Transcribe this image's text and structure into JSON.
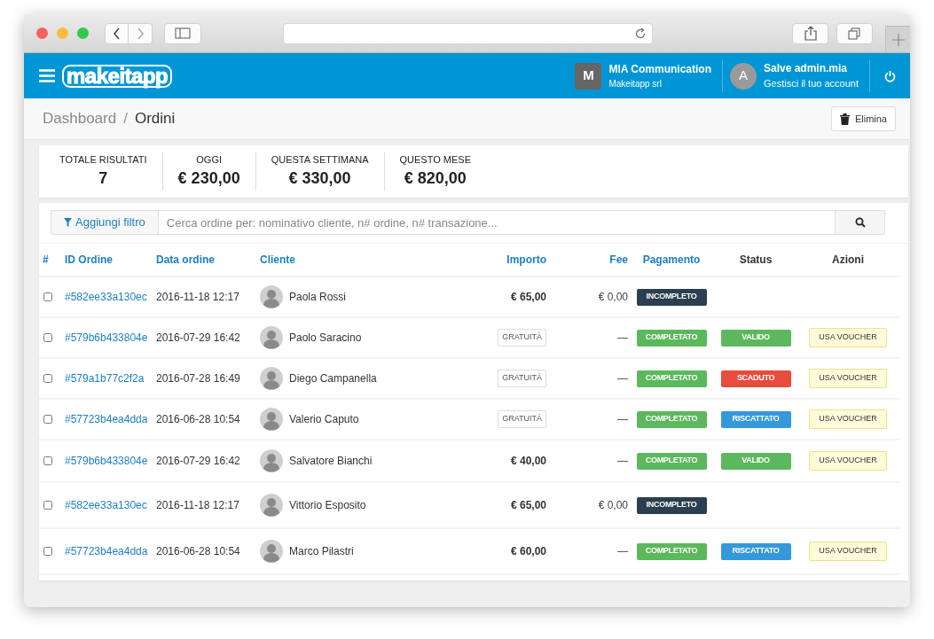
{
  "header": {
    "logo": "makeitapp",
    "company": {
      "initial": "M",
      "name": "MIA Communication",
      "subtitle": "Makeitapp srl"
    },
    "user": {
      "initial": "A",
      "greeting": "Salve admin.mia",
      "link": "Gestisci il tuo account"
    }
  },
  "breadcrumb": {
    "items": [
      {
        "label": "Dashboard",
        "selected": false
      },
      {
        "label": "Ordini",
        "selected": true
      }
    ],
    "separator": "/"
  },
  "delete_button": "Elimina",
  "stats": [
    {
      "label": "TOTALE RISULTATI",
      "value": "7"
    },
    {
      "label": "OGGI",
      "value": "€ 230,00"
    },
    {
      "label": "QUESTA SETTIMANA",
      "value": "€ 330,00"
    },
    {
      "label": "QUESTO MESE",
      "value": "€ 820,00"
    }
  ],
  "filter_button": "Aggiungi filtro",
  "search": {
    "placeholder": "Cerca ordine per: nominativo cliente, n# ordine, n# transazione..."
  },
  "table": {
    "columns": [
      {
        "label": "#",
        "sortable": true
      },
      {
        "label": "ID Ordine",
        "sortable": true
      },
      {
        "label": "Data ordine",
        "sortable": true
      },
      {
        "label": "Cliente",
        "sortable": true
      },
      {
        "label": "Importo",
        "sortable": true
      },
      {
        "label": "Fee",
        "sortable": true
      },
      {
        "label": "Pagamento",
        "sortable": true
      },
      {
        "label": "Status",
        "sortable": false
      },
      {
        "label": "Azioni",
        "sortable": false
      }
    ],
    "rows": [
      {
        "checked": false,
        "id": "#582ee33a130ec",
        "date": "2016-11-18 12:17",
        "client": "Paola Rossi",
        "amount": {
          "kind": "price",
          "text": "€ 65,00"
        },
        "fee": "€ 0,00",
        "payment": {
          "text": "INCOMPLETO",
          "color": "#2c3e50"
        }
      },
      {
        "checked": false,
        "id": "#579b6b433804e",
        "date": "2016-07-29 16:42",
        "client": "Paolo Saracino",
        "amount": {
          "kind": "tag",
          "text": "GRATUITÀ"
        },
        "fee": "—",
        "payment": {
          "text": "COMPLETATO",
          "color": "#5cb85c"
        },
        "status": {
          "text": "VALIDO",
          "color": "#5cb85c"
        },
        "action": "USA VOUCHER"
      },
      {
        "checked": false,
        "id": "#579a1b77c2f2a",
        "date": "2016-07-28 16:49",
        "client": "Diego Campanella",
        "amount": {
          "kind": "tag",
          "text": "GRATUITÀ"
        },
        "fee": "—",
        "payment": {
          "text": "COMPLETATO",
          "color": "#5cb85c"
        },
        "status": {
          "text": "SCADUTO",
          "color": "#e74c3c"
        },
        "action": "USA VOUCHER"
      },
      {
        "checked": false,
        "id": "#57723b4ea4dda",
        "date": "2016-06-28 10:54",
        "client": "Valerio Caputo",
        "amount": {
          "kind": "tag",
          "text": "GRATUITÀ"
        },
        "fee": "—",
        "payment": {
          "text": "COMPLETATO",
          "color": "#5cb85c"
        },
        "status": {
          "text": "RISCATTATO",
          "color": "#3498db"
        },
        "action": "USA VOUCHER"
      },
      {
        "checked": false,
        "id": "#579b6b433804e",
        "date": "2016-07-29 16:42",
        "client": "Salvatore Bianchi",
        "amount": {
          "kind": "price",
          "text": "€ 40,00"
        },
        "fee": "—",
        "payment": {
          "text": "COMPLETATO",
          "color": "#5cb85c"
        },
        "status": {
          "text": "VALIDO",
          "color": "#5cb85c"
        },
        "action": "USA VOUCHER"
      },
      {
        "checked": false,
        "id": "#582ee33a130ec",
        "date": "2016-11-18 12:17",
        "client": "Vittorio Esposito",
        "amount": {
          "kind": "price",
          "text": "€ 65,00"
        },
        "fee": "€ 0,00",
        "payment": {
          "text": "INCOMPLETO",
          "color": "#2c3e50"
        }
      },
      {
        "checked": false,
        "id": "#57723b4ea4dda",
        "date": "2016-06-28 10:54",
        "client": "Marco Pilastri",
        "amount": {
          "kind": "price",
          "text": "€ 60,00"
        },
        "fee": "—",
        "payment": {
          "text": "COMPLETATO",
          "color": "#5cb85c"
        },
        "status": {
          "text": "RISCATTATO",
          "color": "#3498db"
        },
        "action": "USA VOUCHER"
      }
    ]
  }
}
